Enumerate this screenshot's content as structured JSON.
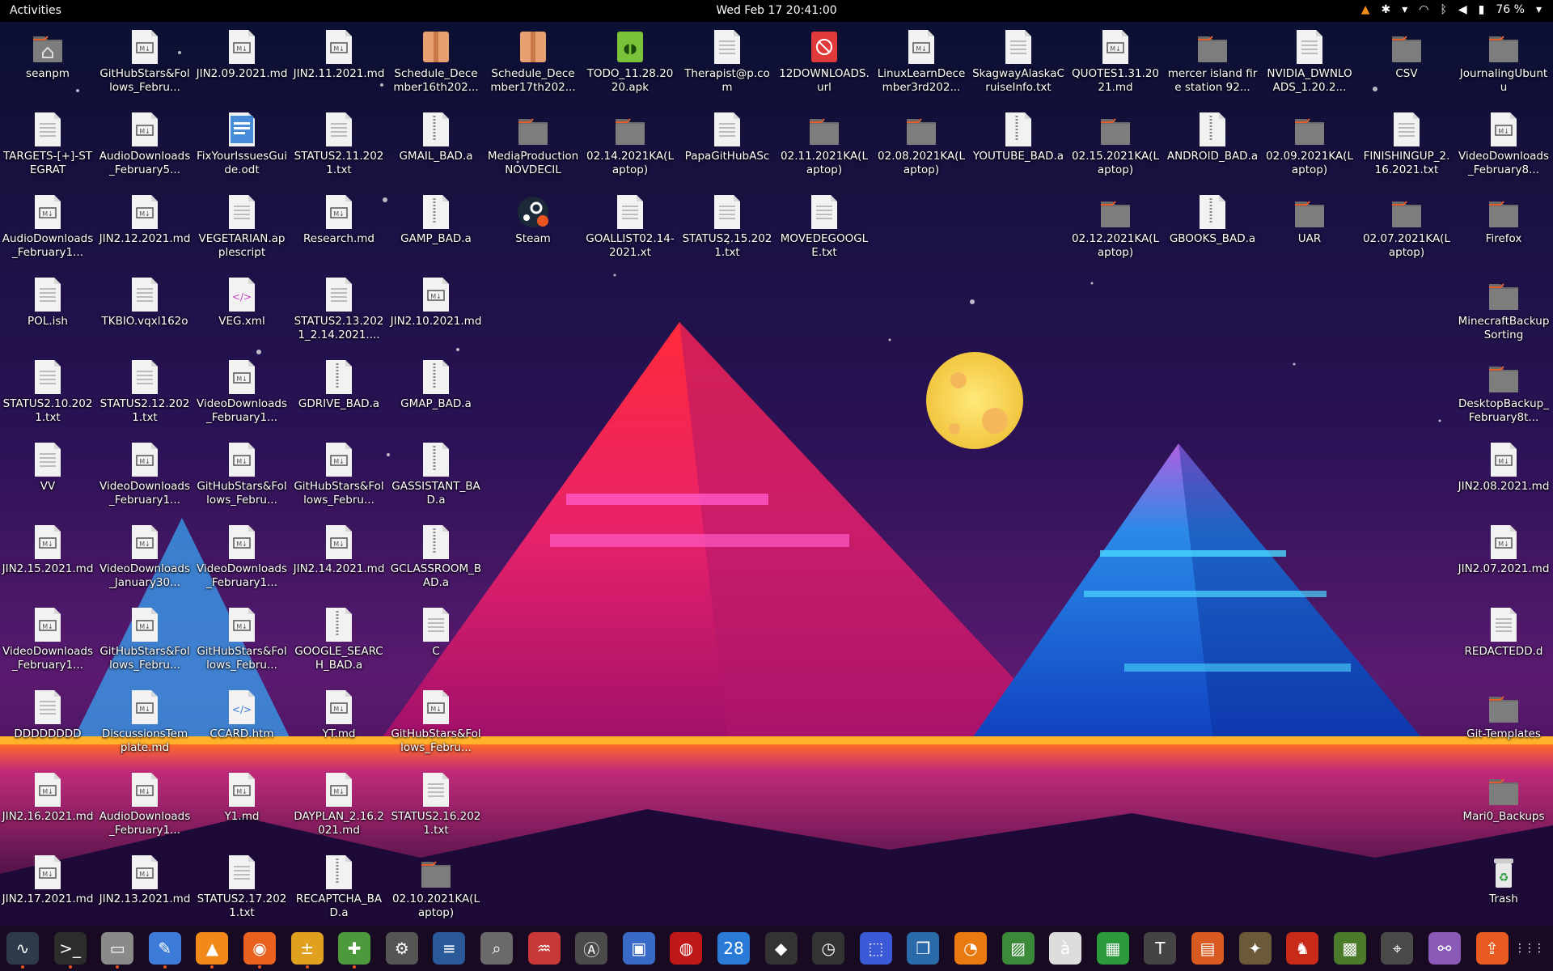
{
  "topbar": {
    "activities": "Activities",
    "clock": "Wed Feb 17  20:41:00",
    "battery": "76 %",
    "tray_icons": [
      "vlc-tray-icon",
      "accessibility-icon",
      "chevron-down-icon",
      "wifi-icon",
      "bluetooth-icon",
      "volume-icon",
      "battery-icon",
      "chevron-down-icon"
    ]
  },
  "desktop": {
    "columns": [
      [
        {
          "label": "seanpm",
          "type": "home"
        },
        {
          "label": "TARGETS-[+]-STEGRAT",
          "type": "text"
        },
        {
          "label": "AudioDownloads_February1...",
          "type": "md"
        },
        {
          "label": "POL.ish",
          "type": "text"
        },
        {
          "label": "STATUS2.10.2021.txt",
          "type": "text"
        },
        {
          "label": "VV",
          "type": "text"
        },
        {
          "label": "JIN2.15.2021.md",
          "type": "md"
        },
        {
          "label": "VideoDownloads_February1...",
          "type": "md"
        },
        {
          "label": "DDDDDDDD",
          "type": "text"
        },
        {
          "label": "JIN2.16.2021.md",
          "type": "md"
        },
        {
          "label": "JIN2.17.2021.md",
          "type": "md"
        }
      ],
      [
        {
          "label": "GitHubStars&Follows_Febru...",
          "type": "md"
        },
        {
          "label": "AudioDownloads_February5...",
          "type": "md"
        },
        {
          "label": "JIN2.12.2021.md",
          "type": "md"
        },
        {
          "label": "TKBIO.vqxl162o",
          "type": "text"
        },
        {
          "label": "STATUS2.12.2021.txt",
          "type": "text"
        },
        {
          "label": "VideoDownloads_February1...",
          "type": "md"
        },
        {
          "label": "VideoDownloads_January30...",
          "type": "md"
        },
        {
          "label": "GitHubStars&Follows_Febru...",
          "type": "md"
        },
        {
          "label": "DiscussionsTemplate.md",
          "type": "md"
        },
        {
          "label": "AudioDownloads_February1...",
          "type": "md"
        },
        {
          "label": "JIN2.13.2021.md",
          "type": "md"
        }
      ],
      [
        {
          "label": "JIN2.09.2021.md",
          "type": "md"
        },
        {
          "label": "FixYourIssuesGuide.odt",
          "type": "odt"
        },
        {
          "label": "VEGETARIAN.applescript",
          "type": "text"
        },
        {
          "label": "VEG.xml",
          "type": "xml"
        },
        {
          "label": "VideoDownloads_February1...",
          "type": "md"
        },
        {
          "label": "GitHubStars&Follows_Febru...",
          "type": "md"
        },
        {
          "label": "VideoDownloads_February1...",
          "type": "md"
        },
        {
          "label": "GitHubStars&Follows_Febru...",
          "type": "md"
        },
        {
          "label": "CCARD.htm",
          "type": "html"
        },
        {
          "label": "Y1.md",
          "type": "md"
        },
        {
          "label": "STATUS2.17.2021.txt",
          "type": "text"
        }
      ],
      [
        {
          "label": "JIN2.11.2021.md",
          "type": "md"
        },
        {
          "label": "STATUS2.11.2021.txt",
          "type": "text"
        },
        {
          "label": "Research.md",
          "type": "md"
        },
        {
          "label": "STATUS2.13.2021_2.14.2021....",
          "type": "text"
        },
        {
          "label": "GDRIVE_BAD.a",
          "type": "archive"
        },
        {
          "label": "GitHubStars&Follows_Febru...",
          "type": "md"
        },
        {
          "label": "JIN2.14.2021.md",
          "type": "md"
        },
        {
          "label": "GOOGLE_SEARCH_BAD.a",
          "type": "archive"
        },
        {
          "label": "YT.md",
          "type": "md"
        },
        {
          "label": "DAYPLAN_2.16.2021.md",
          "type": "md"
        },
        {
          "label": "RECAPTCHA_BAD.a",
          "type": "archive"
        }
      ],
      [
        {
          "label": "Schedule_December16th202...",
          "type": "package"
        },
        {
          "label": "GMAIL_BAD.a",
          "type": "archive"
        },
        {
          "label": "GAMP_BAD.a",
          "type": "archive"
        },
        {
          "label": "JIN2.10.2021.md",
          "type": "md"
        },
        {
          "label": "GMAP_BAD.a",
          "type": "archive"
        },
        {
          "label": "GASSISTANT_BAD.a",
          "type": "archive"
        },
        {
          "label": "GCLASSROOM_BAD.a",
          "type": "archive"
        },
        {
          "label": "C",
          "type": "text"
        },
        {
          "label": "GitHubStars&Follows_Febru...",
          "type": "md"
        },
        {
          "label": "STATUS2.16.2021.txt",
          "type": "text"
        },
        {
          "label": "02.10.2021KA(Laptop)",
          "type": "folder"
        }
      ],
      [
        {
          "label": "Schedule_December17th202...",
          "type": "package"
        },
        {
          "label": "MediaProductionNOVDECIL",
          "type": "folder"
        },
        {
          "label": "Steam",
          "type": "steam"
        }
      ],
      [
        {
          "label": "TODO_11.28.2020.apk",
          "type": "apk"
        },
        {
          "label": "02.14.2021KA(Laptop)",
          "type": "folder"
        },
        {
          "label": "GOALLIST02.14-2021.xt",
          "type": "text"
        }
      ],
      [
        {
          "label": "Therapist@p.com",
          "type": "text"
        },
        {
          "label": "PapaGitHubASc",
          "type": "text"
        },
        {
          "label": "STATUS2.15.2021.txt",
          "type": "text"
        }
      ],
      [
        {
          "label": "12DOWNLOADS.url",
          "type": "url"
        },
        {
          "label": "02.11.2021KA(Laptop)",
          "type": "folder"
        },
        {
          "label": "MOVEDEGOOGLE.txt",
          "type": "text"
        }
      ],
      [
        {
          "label": "LinuxLearnDecember3rd202...",
          "type": "md"
        },
        {
          "label": "02.08.2021KA(Laptop)",
          "type": "folder"
        }
      ],
      [
        {
          "label": "SkagwayAlaskaCruiseInfo.txt",
          "type": "text"
        },
        {
          "label": "YOUTUBE_BAD.a",
          "type": "archive"
        }
      ],
      [
        {
          "label": "QUOTES1.31.2021.md",
          "type": "md"
        },
        {
          "label": "02.15.2021KA(Laptop)",
          "type": "folder"
        },
        {
          "label": "02.12.2021KA(Laptop)",
          "type": "folder"
        }
      ],
      [
        {
          "label": "mercer island fire station 92...",
          "type": "folder"
        },
        {
          "label": "ANDROID_BAD.a",
          "type": "archive"
        },
        {
          "label": "GBOOKS_BAD.a",
          "type": "archive"
        }
      ],
      [
        {
          "label": "NVIDIA_DWNLOADS_1.20.2...",
          "type": "text"
        },
        {
          "label": "02.09.2021KA(Laptop)",
          "type": "folder"
        },
        {
          "label": "UAR",
          "type": "folder"
        }
      ],
      [
        {
          "label": "CSV",
          "type": "folder"
        },
        {
          "label": "FINISHINGUP_2.16.2021.txt",
          "type": "text"
        },
        {
          "label": "02.07.2021KA(Laptop)",
          "type": "folder"
        }
      ],
      [
        {
          "label": "JournalingUbuntu",
          "type": "folder"
        },
        {
          "label": "VideoDownloads_February8...",
          "type": "md"
        },
        {
          "label": "Firefox",
          "type": "folder"
        },
        {
          "label": "MinecraftBackupSorting",
          "type": "folder"
        },
        {
          "label": "DesktopBackup_February8t...",
          "type": "folder"
        },
        {
          "label": "JIN2.08.2021.md",
          "type": "md"
        },
        {
          "label": "JIN2.07.2021.md",
          "type": "md"
        },
        {
          "label": "REDACTEDD.d",
          "type": "text"
        },
        {
          "label": "Git-Templates",
          "type": "folder"
        },
        {
          "label": "Mari0_Backups",
          "type": "folder"
        },
        {
          "label": "Trash",
          "type": "trash"
        }
      ]
    ]
  },
  "dock": {
    "apps": [
      {
        "name": "system-monitor-icon",
        "glyph": "∿",
        "color": "#2f3a4a",
        "running": true
      },
      {
        "name": "terminal-icon",
        "glyph": ">_",
        "color": "#2c2c2c",
        "running": true
      },
      {
        "name": "files-icon",
        "glyph": "▭",
        "color": "#8a8a8a",
        "running": true
      },
      {
        "name": "text-editor-icon",
        "glyph": "✎",
        "color": "#3c7bd8",
        "running": true
      },
      {
        "name": "vlc-icon",
        "glyph": "▲",
        "color": "#f28a1a",
        "running": true
      },
      {
        "name": "firefox-icon",
        "glyph": "◉",
        "color": "#e9601f",
        "running": true
      },
      {
        "name": "calculator-icon",
        "glyph": "±",
        "color": "#e0a020",
        "running": true
      },
      {
        "name": "extensions-icon",
        "glyph": "✚",
        "color": "#4c9a3c",
        "running": true
      },
      {
        "name": "settings-icon",
        "glyph": "⚙",
        "color": "#555555",
        "running": false
      },
      {
        "name": "document-viewer-icon",
        "glyph": "≡",
        "color": "#2a5a9a",
        "running": false
      },
      {
        "name": "search-tool-icon",
        "glyph": "⌕",
        "color": "#6a6a6a",
        "running": false
      },
      {
        "name": "analyzer-icon",
        "glyph": "♒",
        "color": "#c83838",
        "running": false
      },
      {
        "name": "software-center-icon",
        "glyph": "Ⓐ",
        "color": "#4a4a4a",
        "running": false
      },
      {
        "name": "image-viewer-icon",
        "glyph": "▣",
        "color": "#3a6ac8",
        "running": false
      },
      {
        "name": "game-icon",
        "glyph": "◍",
        "color": "#c01818",
        "running": false
      },
      {
        "name": "calendar-icon",
        "glyph": "28",
        "color": "#2a7ad8",
        "running": false
      },
      {
        "name": "inkscape-icon",
        "glyph": "◆",
        "color": "#333333",
        "running": false
      },
      {
        "name": "clock-icon",
        "glyph": "◷",
        "color": "#333333",
        "running": false
      },
      {
        "name": "screenshot-icon",
        "glyph": "⬚",
        "color": "#3a5ad8",
        "running": false
      },
      {
        "name": "virtualbox-icon",
        "glyph": "❒",
        "color": "#2a6aa8",
        "running": false
      },
      {
        "name": "blender-icon",
        "glyph": "◔",
        "color": "#e87a10",
        "running": false
      },
      {
        "name": "photos-icon",
        "glyph": "▨",
        "color": "#3a8a3a",
        "running": false
      },
      {
        "name": "character-map-icon",
        "glyph": "à",
        "color": "#dddddd",
        "running": false
      },
      {
        "name": "spreadsheet-icon",
        "glyph": "▦",
        "color": "#2a9a3a",
        "running": false
      },
      {
        "name": "typora-icon",
        "glyph": "T",
        "color": "#444444",
        "running": false
      },
      {
        "name": "presentation-icon",
        "glyph": "▤",
        "color": "#d85a20",
        "running": false
      },
      {
        "name": "gimp-icon",
        "glyph": "✦",
        "color": "#6a5a3a",
        "running": false
      },
      {
        "name": "mario-icon",
        "glyph": "♞",
        "color": "#c82a1a",
        "running": false
      },
      {
        "name": "minecraft-icon",
        "glyph": "▩",
        "color": "#4a7a2a",
        "running": false
      },
      {
        "name": "maps-icon",
        "glyph": "⌖",
        "color": "#4a4a4a",
        "running": false
      },
      {
        "name": "tweaks-icon",
        "glyph": "⚯",
        "color": "#8a5ab8",
        "running": false
      },
      {
        "name": "store-icon",
        "glyph": "⇪",
        "color": "#e85a20",
        "running": false
      },
      {
        "name": "show-apps-icon",
        "glyph": "⋮⋮⋮",
        "color": "transparent",
        "running": false
      }
    ]
  }
}
